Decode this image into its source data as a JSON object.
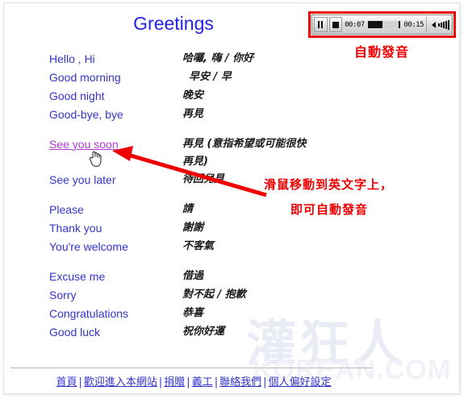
{
  "page": {
    "title": "Greetings",
    "watermark_cjk": "灌狂人",
    "watermark_latin": "KOREAN.COM"
  },
  "player": {
    "pause_icon": "pause-icon",
    "stop_icon": "stop-icon",
    "elapsed": "00:07",
    "total": "00:15",
    "progress_percent": 47,
    "volume_icon": "volume-icon"
  },
  "annotations": {
    "autoplay_label": "自動發音",
    "hover_hint_line1": "滑鼠移動到英文字上，",
    "hover_hint_line2": "即可自動發音"
  },
  "phrases": [
    {
      "en": "Hello , Hi",
      "zh": "哈囉, 嗨 / 你好",
      "active": false,
      "gap": false,
      "indent": false
    },
    {
      "en": "Good morning",
      "zh": "早安 / 早",
      "active": false,
      "gap": false,
      "indent": true
    },
    {
      "en": "Good night",
      "zh": "晚安",
      "active": false,
      "gap": false,
      "indent": false
    },
    {
      "en": "Good-bye, bye",
      "zh": "再見",
      "active": false,
      "gap": false,
      "indent": false
    },
    {
      "en": "See you soon",
      "zh": "再見 (意指希望或可能很快\n再見)",
      "active": true,
      "gap": true,
      "indent": false
    },
    {
      "en": "See you later",
      "zh": "待回兒見",
      "active": false,
      "gap": false,
      "indent": false
    },
    {
      "en": "Please",
      "zh": "請",
      "active": false,
      "gap": true,
      "indent": false
    },
    {
      "en": "Thank you",
      "zh": "謝謝",
      "active": false,
      "gap": false,
      "indent": false
    },
    {
      "en": "You're welcome",
      "zh": "不客氣",
      "active": false,
      "gap": false,
      "indent": false
    },
    {
      "en": "Excuse me",
      "zh": "借過",
      "active": false,
      "gap": true,
      "indent": false
    },
    {
      "en": "Sorry",
      "zh": "對不起 / 抱歉",
      "active": false,
      "gap": false,
      "indent": false
    },
    {
      "en": "Congratulations",
      "zh": "恭喜",
      "active": false,
      "gap": false,
      "indent": false
    },
    {
      "en": "Good luck",
      "zh": "祝你好運",
      "active": false,
      "gap": false,
      "indent": false
    }
  ],
  "footer": {
    "links": [
      "首頁",
      "歡迎進入本網站",
      "捐贈",
      "義工",
      "聯絡我們",
      "個人偏好設定"
    ],
    "separator": "|"
  },
  "colors": {
    "link_blue": "#3333cc",
    "title_blue": "#2222ee",
    "active_purple": "#b03ad0",
    "annotation_red": "#ee0000"
  }
}
